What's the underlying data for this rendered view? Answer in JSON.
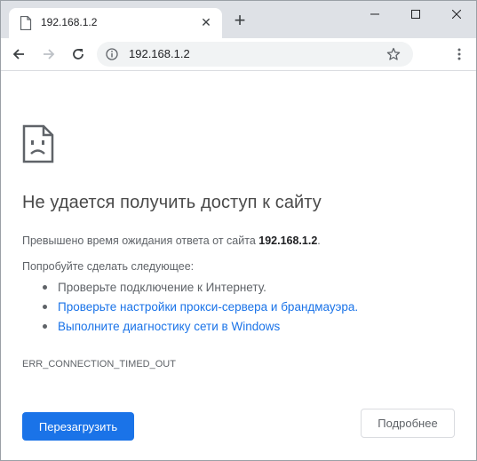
{
  "tab": {
    "title": "192.168.1.2",
    "close_glyph": "✕",
    "new_tab_glyph": "+"
  },
  "window_controls": {
    "minimize_icon": "minimize-icon",
    "maximize_icon": "maximize-icon",
    "close_icon": "close-icon"
  },
  "toolbar": {
    "url": "192.168.1.2",
    "back_icon": "arrow-left-icon",
    "forward_icon": "arrow-right-icon",
    "reload_icon": "reload-icon",
    "info_icon": "info-icon",
    "bookmark_icon": "star-icon",
    "menu_icon": "kebab-menu-icon"
  },
  "error_page": {
    "icon": "sad-document-icon",
    "heading": "Не удается получить доступ к сайту",
    "timeout_text": "Превышено время ожидания ответа от сайта ",
    "timeout_host": "192.168.1.2",
    "timeout_suffix": ".",
    "try_text": "Попробуйте сделать следующее:",
    "suggestions": [
      {
        "label": "Проверьте подключение к Интернету.",
        "is_link": false
      },
      {
        "label": "Проверьте настройки прокси-сервера и брандмауэра.",
        "is_link": true
      },
      {
        "label": "Выполните диагностику сети в Windows",
        "is_link": true
      }
    ],
    "error_code": "ERR_CONNECTION_TIMED_OUT",
    "reload_button": "Перезагрузить",
    "details_button": "Подробнее"
  },
  "colors": {
    "accent": "#1a73e8",
    "tabstrip": "#dee1e6",
    "omnibox": "#f1f3f4",
    "secondary_text": "#5f6368"
  }
}
